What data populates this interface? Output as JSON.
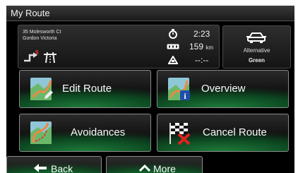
{
  "window": {
    "title": "My Route"
  },
  "route_info": {
    "address_line1": "35 Molesworth Ct",
    "address_line2": "Gordon Victoria",
    "time": "2:23",
    "distance_value": "159",
    "distance_unit": "km",
    "eta": "--:--",
    "route_type_label": "Alternative",
    "route_type_value": "Green"
  },
  "menu": {
    "edit_route": "Edit Route",
    "overview": "Overview",
    "avoidances": "Avoidances",
    "cancel_route": "Cancel Route"
  },
  "bottom_bar": {
    "back": "Back",
    "more": "More"
  },
  "colors": {
    "accent_green": "#1e7a3a",
    "background": "#000000"
  }
}
